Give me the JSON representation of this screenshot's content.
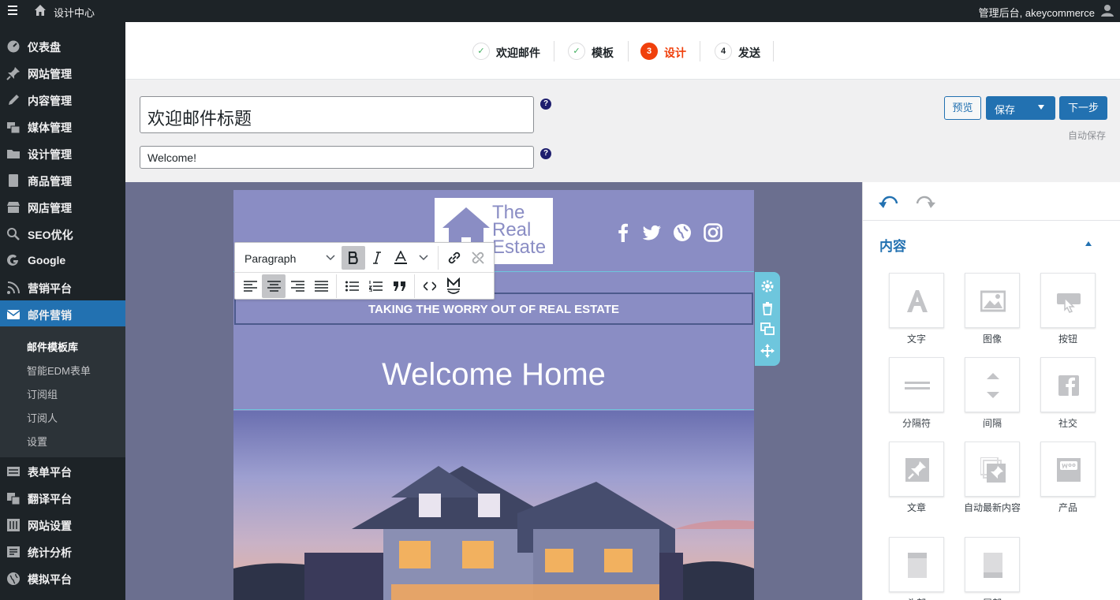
{
  "topbar": {
    "site_name": "设计中心",
    "user_text": "管理后台, akeycommerce"
  },
  "sidebar": {
    "items": [
      {
        "label": "仪表盘",
        "icon": "dashboard-icon"
      },
      {
        "label": "网站管理",
        "icon": "pin-icon"
      },
      {
        "label": "内容管理",
        "icon": "pencil-icon"
      },
      {
        "label": "媒体管理",
        "icon": "media-icon"
      },
      {
        "label": "设计管理",
        "icon": "folder-icon"
      },
      {
        "label": "商品管理",
        "icon": "product-icon"
      },
      {
        "label": "网店管理",
        "icon": "store-icon"
      },
      {
        "label": "SEO优化",
        "icon": "search-icon"
      },
      {
        "label": "Google",
        "icon": "google-icon"
      },
      {
        "label": "营销平台",
        "icon": "rss-icon"
      },
      {
        "label": "邮件营销",
        "icon": "mail-icon"
      },
      {
        "label": "表单平台",
        "icon": "form-icon"
      },
      {
        "label": "翻译平台",
        "icon": "translate-icon"
      },
      {
        "label": "网站设置",
        "icon": "settings-icon"
      },
      {
        "label": "统计分析",
        "icon": "analytics-icon"
      },
      {
        "label": "模拟平台",
        "icon": "globe-icon"
      }
    ],
    "submenu": [
      "邮件模板库",
      "智能EDM表单",
      "订阅组",
      "订阅人",
      "设置"
    ]
  },
  "steps": [
    {
      "num": "✓",
      "label": "欢迎邮件"
    },
    {
      "num": "✓",
      "label": "模板"
    },
    {
      "num": "3",
      "label": "设计"
    },
    {
      "num": "4",
      "label": "发送"
    }
  ],
  "header": {
    "subject_value": "欢迎邮件标题",
    "preheader_value": "Welcome!",
    "help": "?",
    "preview_label": "预览",
    "save_label": "保存",
    "next_label": "下一步",
    "autosave": "自动保存"
  },
  "email": {
    "logo_text": [
      "The",
      "Real",
      "Estate"
    ],
    "tagline": "TAKING THE WORRY OUT OF REAL ESTATE",
    "heading": "Welcome Home"
  },
  "toolbar": {
    "format": "Paragraph"
  },
  "panel": {
    "title": "内容",
    "widgets": [
      "文字",
      "图像",
      "按钮",
      "分隔符",
      "间隔",
      "社交",
      "文章",
      "自动最新内容",
      "产品",
      "头部",
      "尾部"
    ]
  },
  "colors": {
    "admin_bar": "#1d2327",
    "accent": "#2271b1",
    "current_step": "#f0400c",
    "email_bg": "#8a8dc4",
    "selection": "#6ec6dd"
  }
}
